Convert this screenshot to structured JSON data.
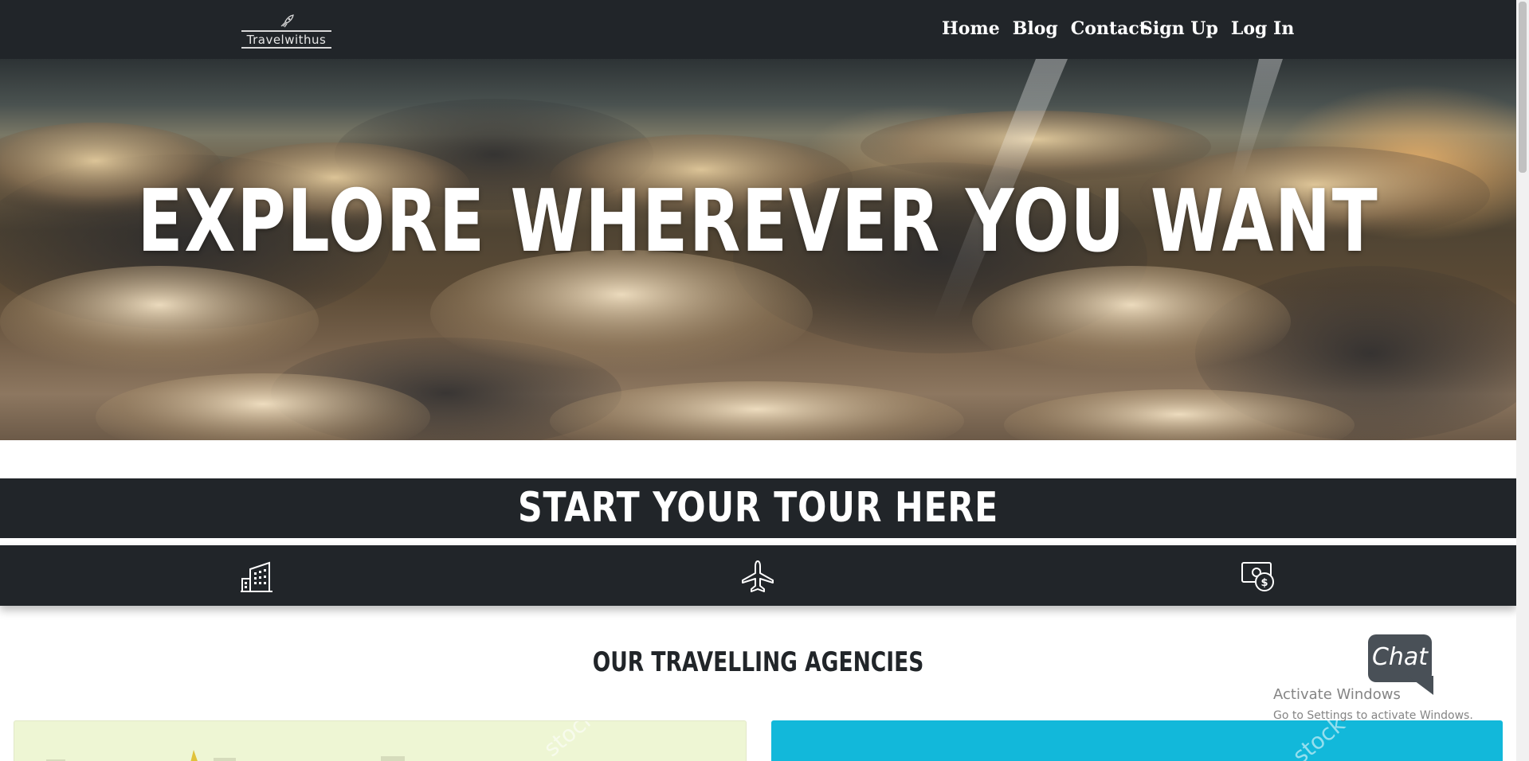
{
  "brand": {
    "name": "Travelwithus",
    "icon": "rocket-icon"
  },
  "nav": {
    "items": [
      {
        "label": "Home"
      },
      {
        "label": "Blog"
      },
      {
        "label": "Contact"
      }
    ],
    "auth": [
      {
        "label": "Sign Up"
      },
      {
        "label": "Log In"
      }
    ]
  },
  "hero": {
    "title": "EXPLORE WHEREVER YOU WANT"
  },
  "tour": {
    "title": "START YOUR TOUR HERE",
    "icons": [
      {
        "name": "hotel-building-icon"
      },
      {
        "name": "airplane-icon"
      },
      {
        "name": "money-dollar-icon"
      }
    ]
  },
  "agencies": {
    "title": "OUR TRAVELLING AGENCIES",
    "cards": [
      {
        "color": "#eef6d4"
      },
      {
        "color": "#12b8da"
      }
    ]
  },
  "chat": {
    "label": "Chat"
  },
  "windows_notice": {
    "title": "Activate Windows",
    "subtitle": "Go to Settings to activate Windows."
  },
  "colors": {
    "dark": "#212529",
    "accent_cyan": "#12b8da",
    "chat": "#495057"
  }
}
